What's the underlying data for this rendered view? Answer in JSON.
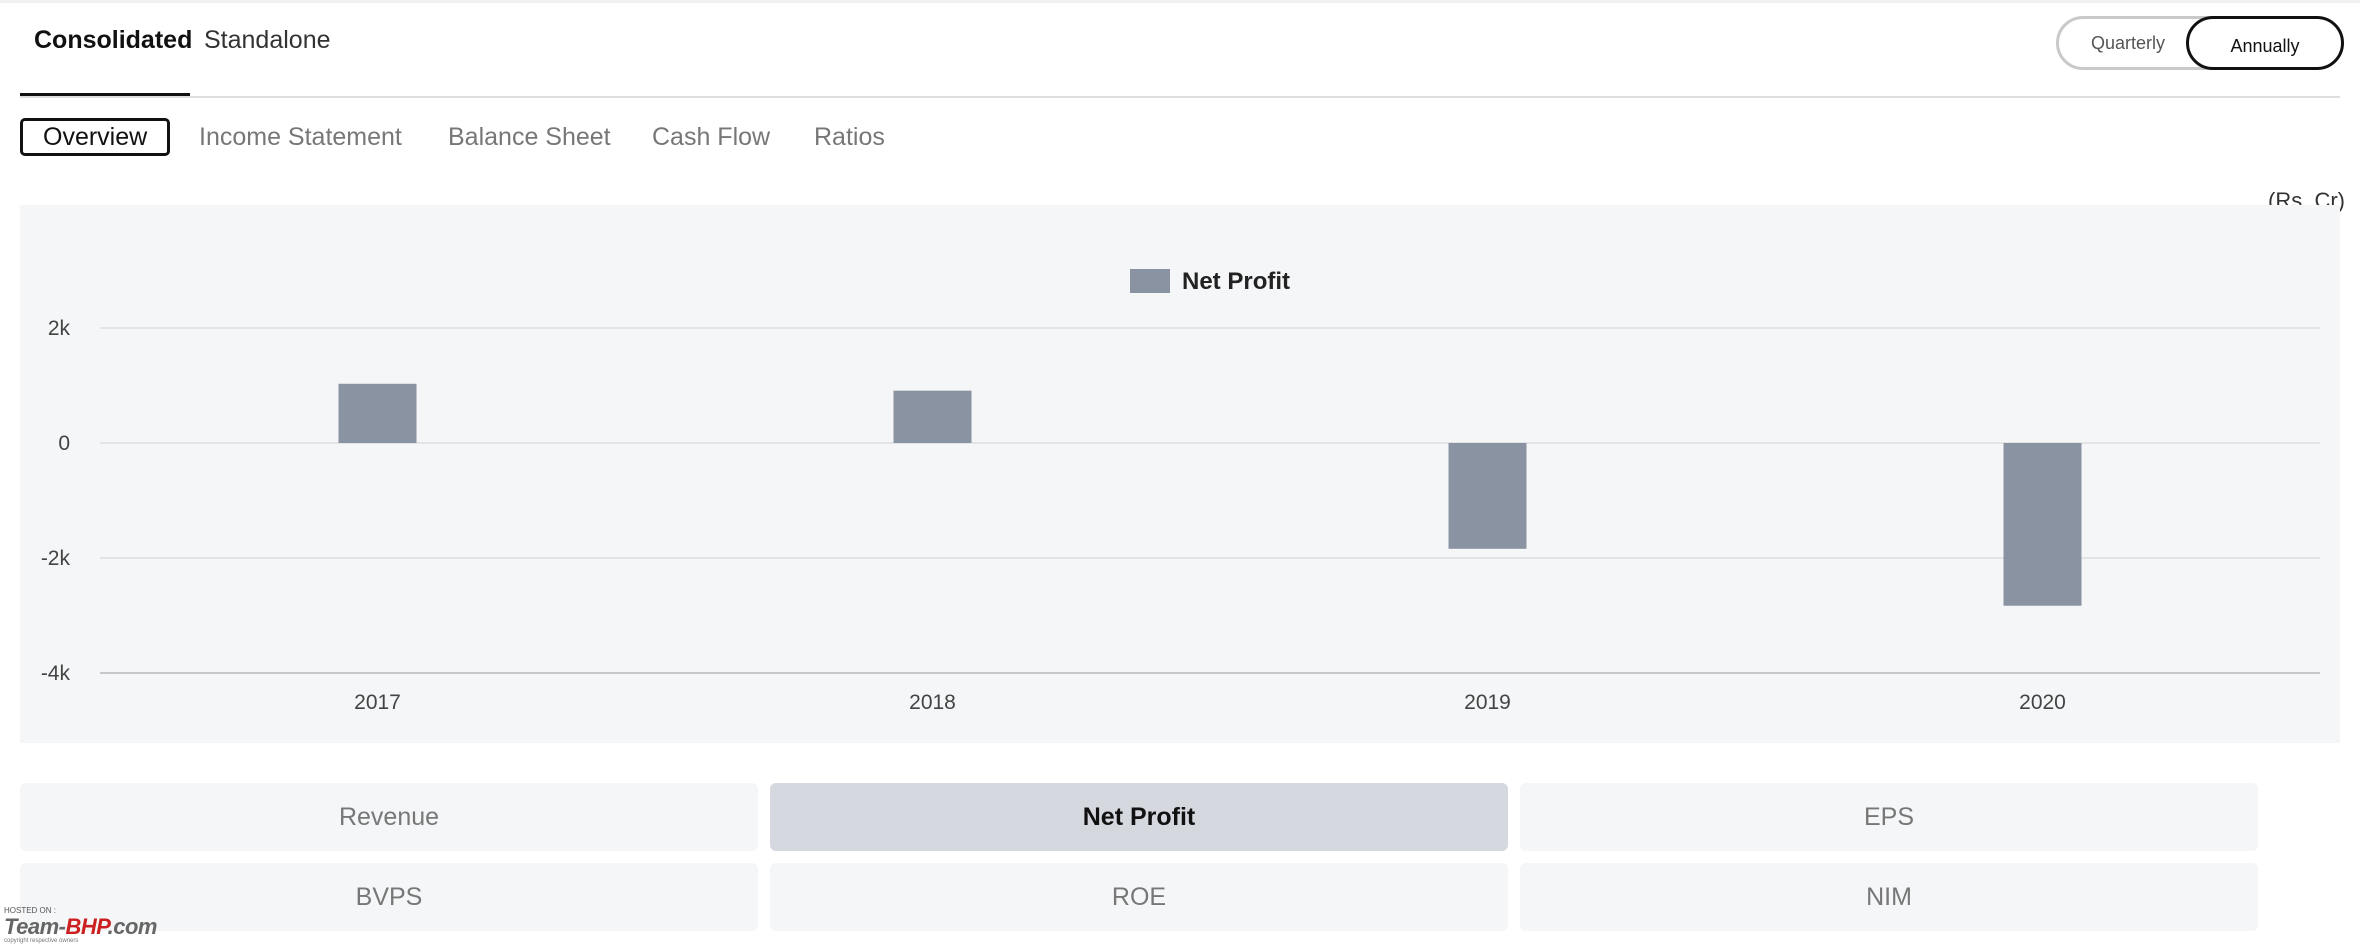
{
  "primary_tabs": [
    {
      "label": "Consolidated",
      "active": true
    },
    {
      "label": "Standalone",
      "active": false
    }
  ],
  "period_toggle": {
    "quarterly_label": "Quarterly",
    "annually_label": "Annually",
    "selected": "Annually"
  },
  "sub_tabs": [
    {
      "label": "Overview",
      "active": true
    },
    {
      "label": "Income Statement",
      "active": false
    },
    {
      "label": "Balance Sheet",
      "active": false
    },
    {
      "label": "Cash Flow",
      "active": false
    },
    {
      "label": "Ratios",
      "active": false
    }
  ],
  "unit_label": "(Rs. Cr)",
  "chart_data": {
    "type": "bar",
    "title": "",
    "xlabel": "",
    "ylabel": "",
    "categories": [
      "2017",
      "2018",
      "2019",
      "2020"
    ],
    "series": [
      {
        "name": "Net Profit",
        "values": [
          1030,
          910,
          -1840,
          -2830
        ],
        "color": "#8a93a2"
      }
    ],
    "ylim": [
      -4000,
      2000
    ],
    "yticks": [
      2000,
      0,
      -2000,
      -4000
    ],
    "ytick_labels": [
      "2k",
      "0",
      "-2k",
      "-4k"
    ],
    "legend_position": "top-center",
    "grid": true
  },
  "metrics": [
    {
      "label": "Revenue",
      "active": false
    },
    {
      "label": "Net Profit",
      "active": true
    },
    {
      "label": "EPS",
      "active": false
    },
    {
      "label": "BVPS",
      "active": false
    },
    {
      "label": "ROE",
      "active": false
    },
    {
      "label": "NIM",
      "active": false
    }
  ],
  "watermark": {
    "hosted_text": "HOSTED ON :",
    "brand_prefix": "Team-",
    "brand_highlight": "BHP",
    "brand_suffix": ".com",
    "copyright_text": "copyright respective owners"
  }
}
